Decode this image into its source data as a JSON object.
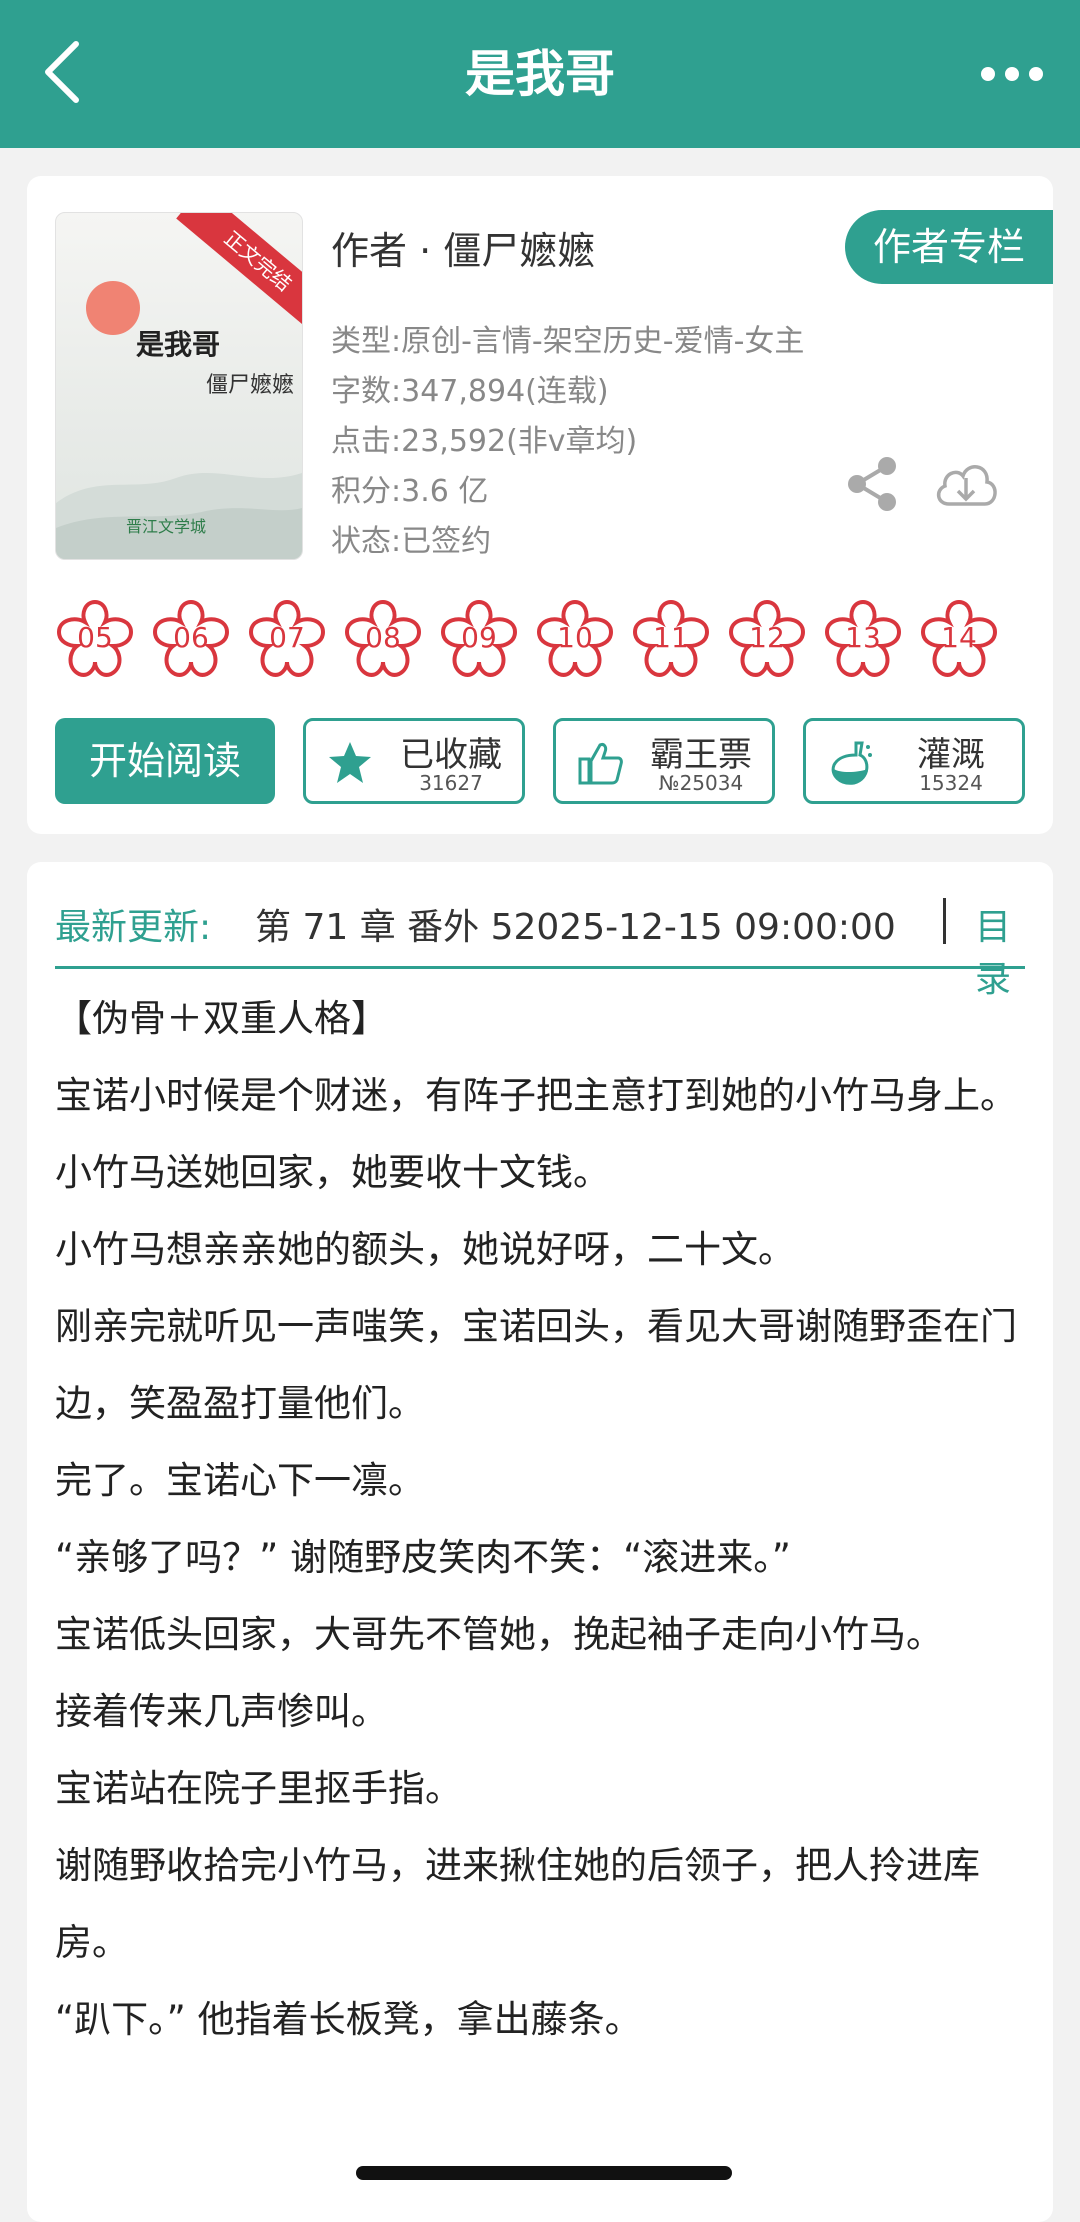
{
  "header": {
    "title": "是我哥",
    "back_icon": "chevron-left-icon",
    "more_icon": "more-dots-icon"
  },
  "book": {
    "cover": {
      "banner": "正文完结",
      "title": "是我哥",
      "author": "僵尸嬷嬷",
      "logo": "晋江文学城"
    },
    "author_line": "作者 · 僵尸嬷嬷",
    "author_column_label": "作者专栏",
    "meta": {
      "type": "类型:原创-言情-架空历史-爱情-女主",
      "words": "字数:347,894(连载)",
      "clicks": "点击:23,592(非v章均)",
      "score": "积分:3.6 亿",
      "status": "状态:已签约"
    },
    "flower_badges": [
      "05",
      "06",
      "07",
      "08",
      "09",
      "10",
      "11",
      "12",
      "13",
      "14"
    ],
    "buttons": {
      "read": "开始阅读",
      "collected": {
        "label": "已收藏",
        "count": "31627",
        "icon": "star-icon"
      },
      "tickets": {
        "label": "霸王票",
        "count": "№25034",
        "icon": "thumbs-up-icon"
      },
      "nutrient": {
        "label": "灌溉",
        "count": "15324",
        "icon": "watering-flask-icon"
      }
    }
  },
  "update": {
    "label": "最新更新:",
    "text": "第 71 章 番外 52025-12-15 09:00:00",
    "toc": "目录"
  },
  "synopsis": [
    "【伪骨＋双重人格】",
    "宝诺小时候是个财迷，有阵子把主意打到她的小竹马身上。",
    "小竹马送她回家，她要收十文钱。",
    "小竹马想亲亲她的额头，她说好呀，二十文。",
    "刚亲完就听见一声嗤笑，宝诺回头，看见大哥谢随野歪在门边，笑盈盈打量他们。",
    "完了。宝诺心下一凛。",
    "“亲够了吗？” 谢随野皮笑肉不笑：“滚进来。”",
    "宝诺低头回家，大哥先不管她，挽起袖子走向小竹马。",
    "接着传来几声惨叫。",
    "宝诺站在院子里抠手指。",
    "谢随野收拾完小竹马，进来揪住她的后领子，把人拎进库房。",
    "“趴下。” 他指着长板凳，拿出藤条。"
  ],
  "colors": {
    "brand": "#2fa090",
    "badge_red": "#d9363e"
  }
}
